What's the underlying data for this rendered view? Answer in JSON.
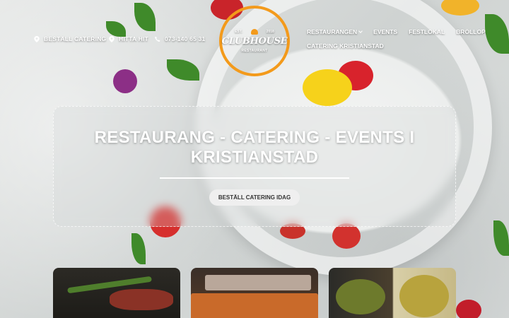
{
  "header": {
    "contacts": [
      {
        "icon": "map-pin-icon",
        "label": "BESTÄLL CATERING"
      },
      {
        "icon": "map-pin-icon",
        "label": "HITTA HIT"
      },
      {
        "icon": "phone-icon",
        "label": "073-140 65 31"
      }
    ],
    "logo": {
      "est": "EST.",
      "year": "2018",
      "name": "CLUBHOUSE",
      "sub": "RESTAURANT"
    },
    "nav": {
      "items_row1": [
        "RESTAURANGEN",
        "EVENTS",
        "FESTLOKAL",
        "BRÖLLOP"
      ],
      "items_row2": [
        "CATERING KRISTIANSTAD"
      ]
    }
  },
  "hero": {
    "title": "RESTAURANG - CATERING - EVENTS I KRISTIANSTAD",
    "cta_label": "BESTÄLL CATERING IDAG"
  },
  "colors": {
    "accent": "#f39a1b",
    "text_light": "#ffffff",
    "button_bg": "#efefef"
  }
}
